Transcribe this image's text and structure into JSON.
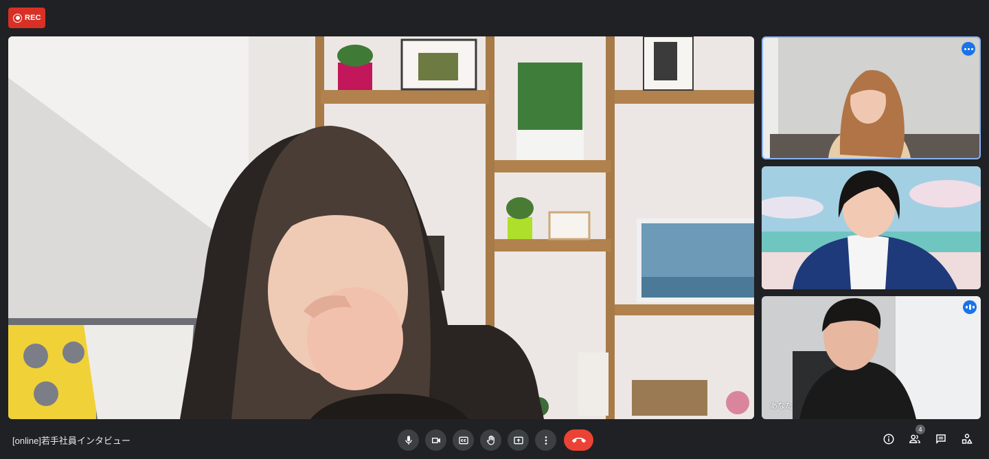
{
  "recording": {
    "label": "REC",
    "color": "#d93025"
  },
  "meeting": {
    "title": "[online]若手社員インタビュー"
  },
  "participants": [
    {
      "role": "main-speaker"
    },
    {
      "role": "side-tile",
      "status_icon": "more-options-icon",
      "active_speaker": true
    },
    {
      "role": "side-tile"
    },
    {
      "role": "side-tile",
      "name": "あなた",
      "status_icon": "audio-level-icon"
    }
  ],
  "controls": [
    {
      "name": "microphone",
      "icon": "mic-icon"
    },
    {
      "name": "camera",
      "icon": "video-camera-icon"
    },
    {
      "name": "captions",
      "icon": "closed-captions-icon"
    },
    {
      "name": "raise-hand",
      "icon": "hand-icon"
    },
    {
      "name": "present",
      "icon": "present-screen-icon"
    },
    {
      "name": "more-options",
      "icon": "more-vert-icon"
    },
    {
      "name": "leave-call",
      "icon": "hangup-icon",
      "color": "#ea4335"
    }
  ],
  "side_panel": {
    "info_icon": "info-icon",
    "people_icon": "people-icon",
    "people_count": "4",
    "chat_icon": "chat-icon",
    "activities_icon": "activities-icon"
  },
  "colors": {
    "background": "#202124",
    "button": "#3c4043",
    "active_border": "#8ab4f8",
    "accent": "#1a73e8"
  }
}
